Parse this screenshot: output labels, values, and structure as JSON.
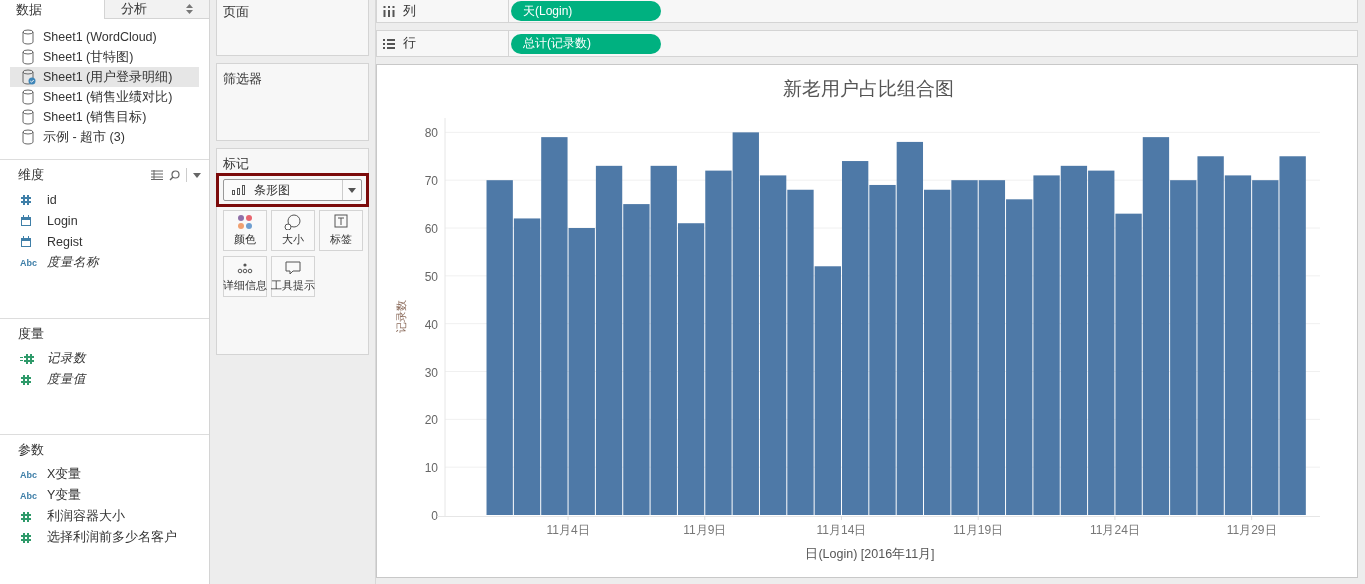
{
  "data_pane": {
    "tabs": [
      {
        "label": "数据",
        "selected": true
      },
      {
        "label": "分析",
        "selected": false
      }
    ],
    "sources": [
      {
        "label": "Sheet1 (WordCloud)",
        "selected": false
      },
      {
        "label": "Sheet1 (甘特图)",
        "selected": false
      },
      {
        "label": "Sheet1 (用户登录明细)",
        "selected": true
      },
      {
        "label": "Sheet1 (销售业绩对比)",
        "selected": false
      },
      {
        "label": "Sheet1 (销售目标)",
        "selected": false
      },
      {
        "label": "示例 - 超市 (3)",
        "selected": false
      }
    ],
    "sections": [
      {
        "title": "维度",
        "tools": true,
        "fields": [
          {
            "kind": "number",
            "color": "#3f7fa8",
            "label": "id",
            "italic": false
          },
          {
            "kind": "date",
            "color": "#3f7fa8",
            "label": "Login",
            "italic": false
          },
          {
            "kind": "date",
            "color": "#3f7fa8",
            "label": "Regist",
            "italic": false
          },
          {
            "kind": "text",
            "color": "#3f7fa8",
            "icon_text": "Abc",
            "label": "度量名称",
            "italic": true
          }
        ]
      },
      {
        "title": "度量",
        "tools": false,
        "fields": [
          {
            "kind": "calc",
            "color": "#2f9a6a",
            "label": "记录数",
            "italic": true
          },
          {
            "kind": "number",
            "color": "#2f9a6a",
            "label": "度量值",
            "italic": true
          }
        ]
      },
      {
        "title": "参数",
        "tools": false,
        "fields": [
          {
            "kind": "text",
            "color": "#3f7fa8",
            "icon_text": "Abc",
            "label": "X变量",
            "italic": false
          },
          {
            "kind": "text",
            "color": "#3f7fa8",
            "icon_text": "Abc",
            "label": "Y变量",
            "italic": false
          },
          {
            "kind": "number",
            "color": "#2f9a6a",
            "label": "利润容器大小",
            "italic": false
          },
          {
            "kind": "number",
            "color": "#2f9a6a",
            "label": "选择利润前多少名客户",
            "italic": false
          }
        ]
      }
    ]
  },
  "cards": {
    "pages": {
      "title": "页面"
    },
    "filters": {
      "title": "筛选器"
    },
    "marks": {
      "title": "标记",
      "mark_type": "条形图",
      "highlighted": true,
      "buttons": [
        {
          "kind": "color",
          "label": "颜色"
        },
        {
          "kind": "size",
          "label": "大小"
        },
        {
          "kind": "label",
          "label": "标签"
        },
        {
          "kind": "detail",
          "label": "详细信息"
        },
        {
          "kind": "tooltip",
          "label": "工具提示"
        }
      ]
    }
  },
  "shelves": [
    {
      "kind": "columns",
      "label": "列",
      "pill": "天(Login)"
    },
    {
      "kind": "rows",
      "label": "行",
      "pill": "总计(记录数)"
    }
  ],
  "chart": {
    "chart_data": {
      "type": "bar",
      "title": "新老用户占比组合图",
      "xlabel": "日(Login) [2016年11月]",
      "ylabel": "记录数",
      "categories": [
        null,
        null,
        null,
        "11月4日",
        null,
        null,
        null,
        null,
        "11月9日",
        null,
        null,
        null,
        null,
        "11月14日",
        null,
        null,
        null,
        null,
        "11月19日",
        null,
        null,
        null,
        null,
        "11月24日",
        null,
        null,
        null,
        null,
        "11月29日",
        null
      ],
      "values": [
        70,
        62,
        79,
        60,
        73,
        65,
        73,
        61,
        72,
        80,
        71,
        68,
        52,
        74,
        69,
        78,
        68,
        70,
        70,
        66,
        71,
        73,
        72,
        63,
        79,
        70,
        75,
        71,
        70,
        75
      ],
      "ylim": [
        0,
        83
      ],
      "grid": true,
      "yticks": [
        0,
        10,
        20,
        30,
        40,
        50,
        60,
        70,
        80
      ]
    }
  }
}
